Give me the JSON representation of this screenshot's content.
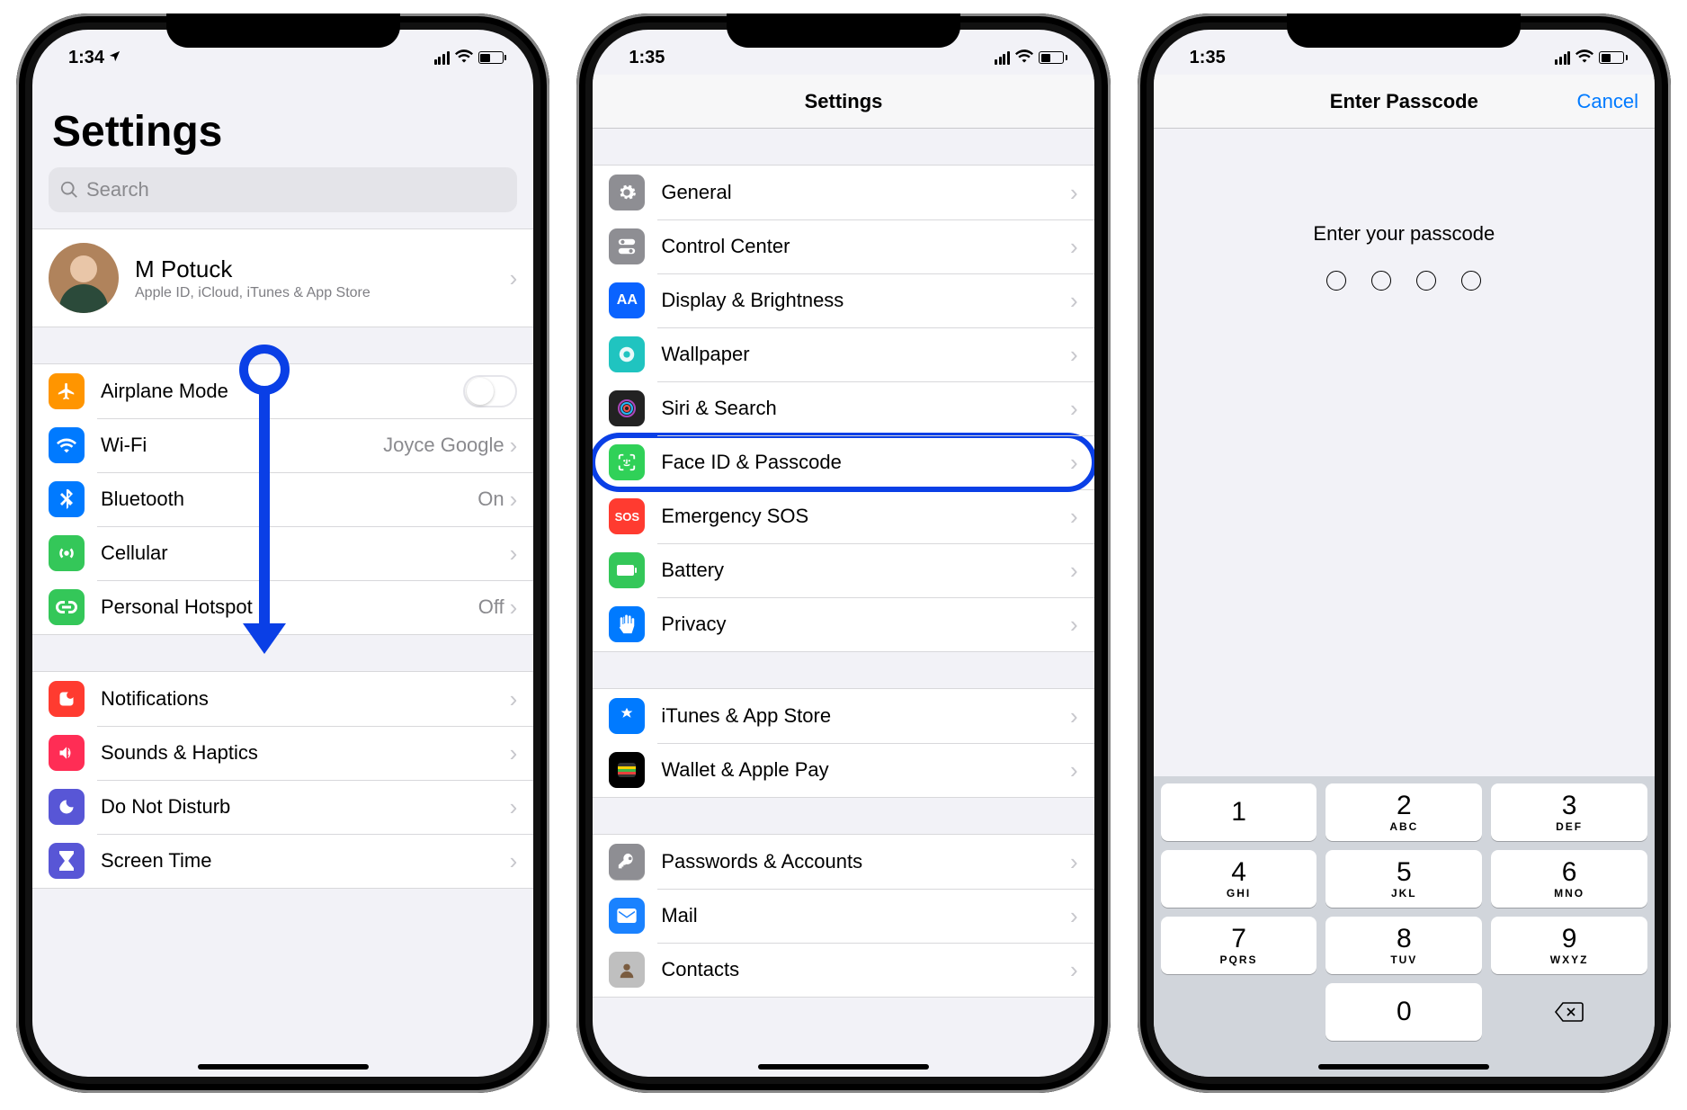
{
  "status": {
    "s1_time": "1:34",
    "s2_time": "1:35",
    "s3_time": "1:35"
  },
  "screen1": {
    "title": "Settings",
    "search_placeholder": "Search",
    "user": {
      "name": "M Potuck",
      "subtitle": "Apple ID, iCloud, iTunes & App Store"
    },
    "rows": {
      "airplane": "Airplane Mode",
      "wifi": "Wi-Fi",
      "wifi_value": "Joyce Google",
      "bluetooth": "Bluetooth",
      "bluetooth_value": "On",
      "cellular": "Cellular",
      "hotspot": "Personal Hotspot",
      "hotspot_value": "Off",
      "notifications": "Notifications",
      "sounds": "Sounds & Haptics",
      "dnd": "Do Not Disturb",
      "screentime": "Screen Time"
    }
  },
  "screen2": {
    "nav_title": "Settings",
    "rows": {
      "general": "General",
      "control_center": "Control Center",
      "display": "Display & Brightness",
      "wallpaper": "Wallpaper",
      "siri": "Siri & Search",
      "faceid": "Face ID & Passcode",
      "sos": "Emergency SOS",
      "battery": "Battery",
      "privacy": "Privacy",
      "itunes": "iTunes & App Store",
      "wallet": "Wallet & Apple Pay",
      "passwords": "Passwords & Accounts",
      "mail": "Mail",
      "contacts": "Contacts"
    },
    "sos_icon_text": "SOS",
    "aa_icon_text": "AA"
  },
  "screen3": {
    "nav_title": "Enter Passcode",
    "cancel": "Cancel",
    "prompt": "Enter your passcode",
    "keypad": [
      {
        "num": "1",
        "sub": ""
      },
      {
        "num": "2",
        "sub": "ABC"
      },
      {
        "num": "3",
        "sub": "DEF"
      },
      {
        "num": "4",
        "sub": "GHI"
      },
      {
        "num": "5",
        "sub": "JKL"
      },
      {
        "num": "6",
        "sub": "MNO"
      },
      {
        "num": "7",
        "sub": "PQRS"
      },
      {
        "num": "8",
        "sub": "TUV"
      },
      {
        "num": "9",
        "sub": "WXYZ"
      },
      {
        "num": "0",
        "sub": ""
      }
    ]
  }
}
